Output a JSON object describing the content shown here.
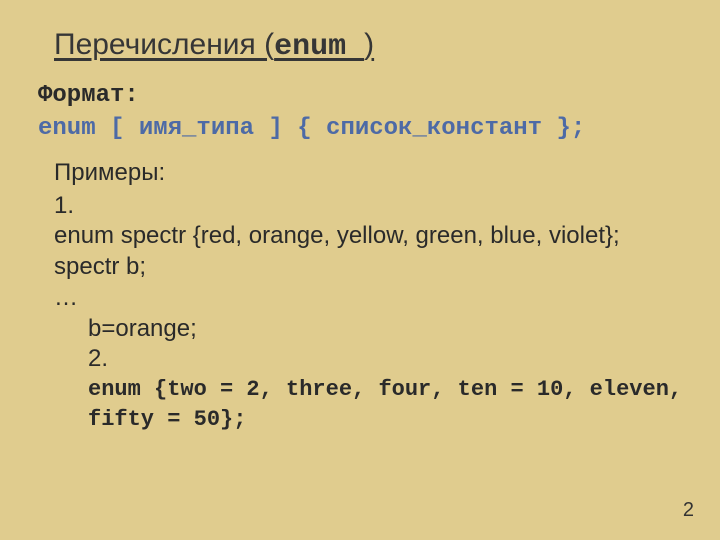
{
  "title_prefix": "Перечисления (",
  "title_kw": "enum ",
  "title_suffix": ")",
  "format_label": "Формат:",
  "format_code": "enum [ имя_типа ] { список_констант };",
  "examples_header": "Примеры:",
  "ex1_num": "1.",
  "ex1_l1": "enum spectr {red, orange, yellow, green, blue, violet};",
  "ex1_l2": "spectr b;",
  "ex1_l3": "…",
  "ex1_l4": "b=orange;",
  "ex2_num": "2.",
  "ex2_l1": "enum {two = 2, three, four, ten = 10, eleven,",
  "ex2_l2": "fifty = 50};",
  "page": "2"
}
